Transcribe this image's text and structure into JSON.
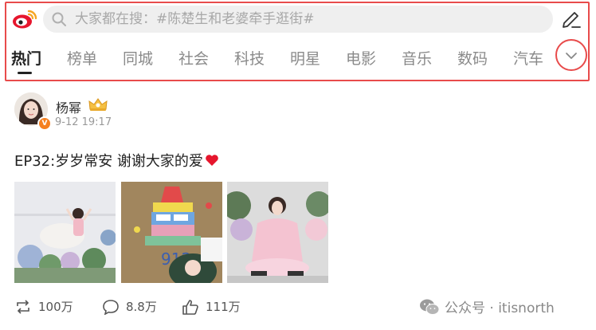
{
  "search": {
    "placeholder": "大家都在搜：#陈楚生和老婆牵手逛街#"
  },
  "tabs": [
    "热门",
    "榜单",
    "同城",
    "社会",
    "科技",
    "明星",
    "电影",
    "音乐",
    "数码",
    "汽车"
  ],
  "active_tab": "热门",
  "post": {
    "username": "杨幂",
    "timestamp": "9-12 19:17",
    "verified_mark": "V",
    "text": "EP32:岁岁常安 谢谢大家的爱",
    "stats": {
      "reposts": "100万",
      "comments": "8.8万",
      "likes": "111万"
    }
  },
  "watermark": {
    "label": "公众号 · itisnorth"
  },
  "colors": {
    "highlight": "#e84b4b",
    "weibo_red": "#e6162d",
    "weibo_orange": "#f5a623",
    "muted": "#8a8a8a"
  },
  "icons": [
    "weibo-logo-icon",
    "search-icon",
    "edit-pencil-icon",
    "chevron-down-icon",
    "crown-badge-icon",
    "heart-icon",
    "repost-icon",
    "comment-icon",
    "like-icon",
    "wechat-icon"
  ]
}
